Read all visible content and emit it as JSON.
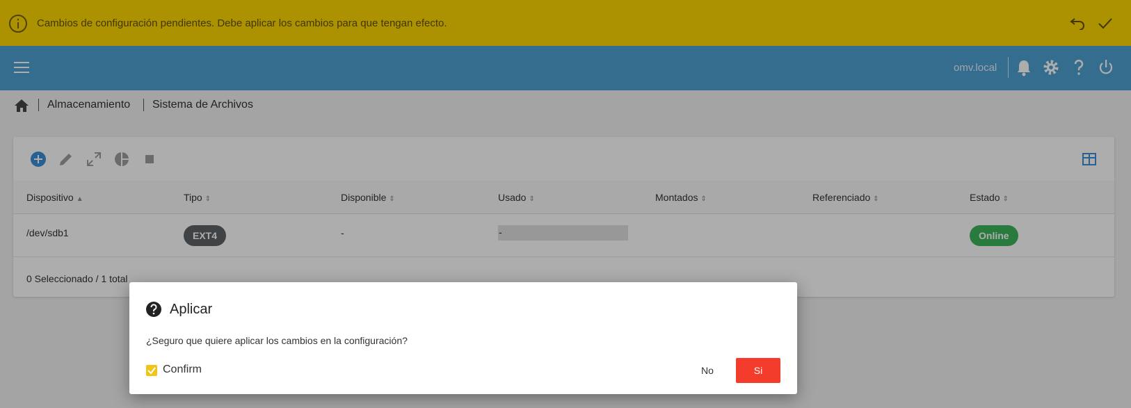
{
  "banner": {
    "message": "Cambios de configuración pendientes. Debe aplicar los cambios para que tengan efecto.",
    "icons": [
      "info-icon",
      "undo-icon",
      "check-icon"
    ],
    "color": "#e6c200"
  },
  "topbar": {
    "hostname": "omv.local",
    "icons": [
      "menu-icon",
      "bell-icon",
      "gear-icon",
      "help-icon",
      "power-icon"
    ],
    "color": "#4ea1d3"
  },
  "breadcrumb": {
    "items": [
      "Almacenamiento",
      "Sistema de Archivos"
    ]
  },
  "table": {
    "toolbar_icons": [
      "add-icon",
      "edit-icon",
      "resize-icon",
      "pie-chart-icon",
      "stop-icon",
      "columns-icon"
    ],
    "columns": [
      "Dispositivo",
      "Tipo",
      "Disponible",
      "Usado",
      "Montados",
      "Referenciado",
      "Estado"
    ],
    "sorted_column": "Dispositivo",
    "rows": [
      {
        "dispositivo": "/dev/sdb1",
        "tipo": "EXT4",
        "disponible": "-",
        "usado": "-",
        "usado_fraction": 0,
        "montados": "",
        "referenciado": "",
        "estado": "Online"
      }
    ],
    "footer": "0 Seleccionado / 1 total"
  },
  "dialog": {
    "title": "Aplicar",
    "message": "¿Seguro que quiere aplicar los cambios en la configuración?",
    "checkbox_label": "Confirm",
    "checkbox_checked": true,
    "no_label": "No",
    "yes_label": "Si",
    "yes_color": "#f43c2d"
  }
}
